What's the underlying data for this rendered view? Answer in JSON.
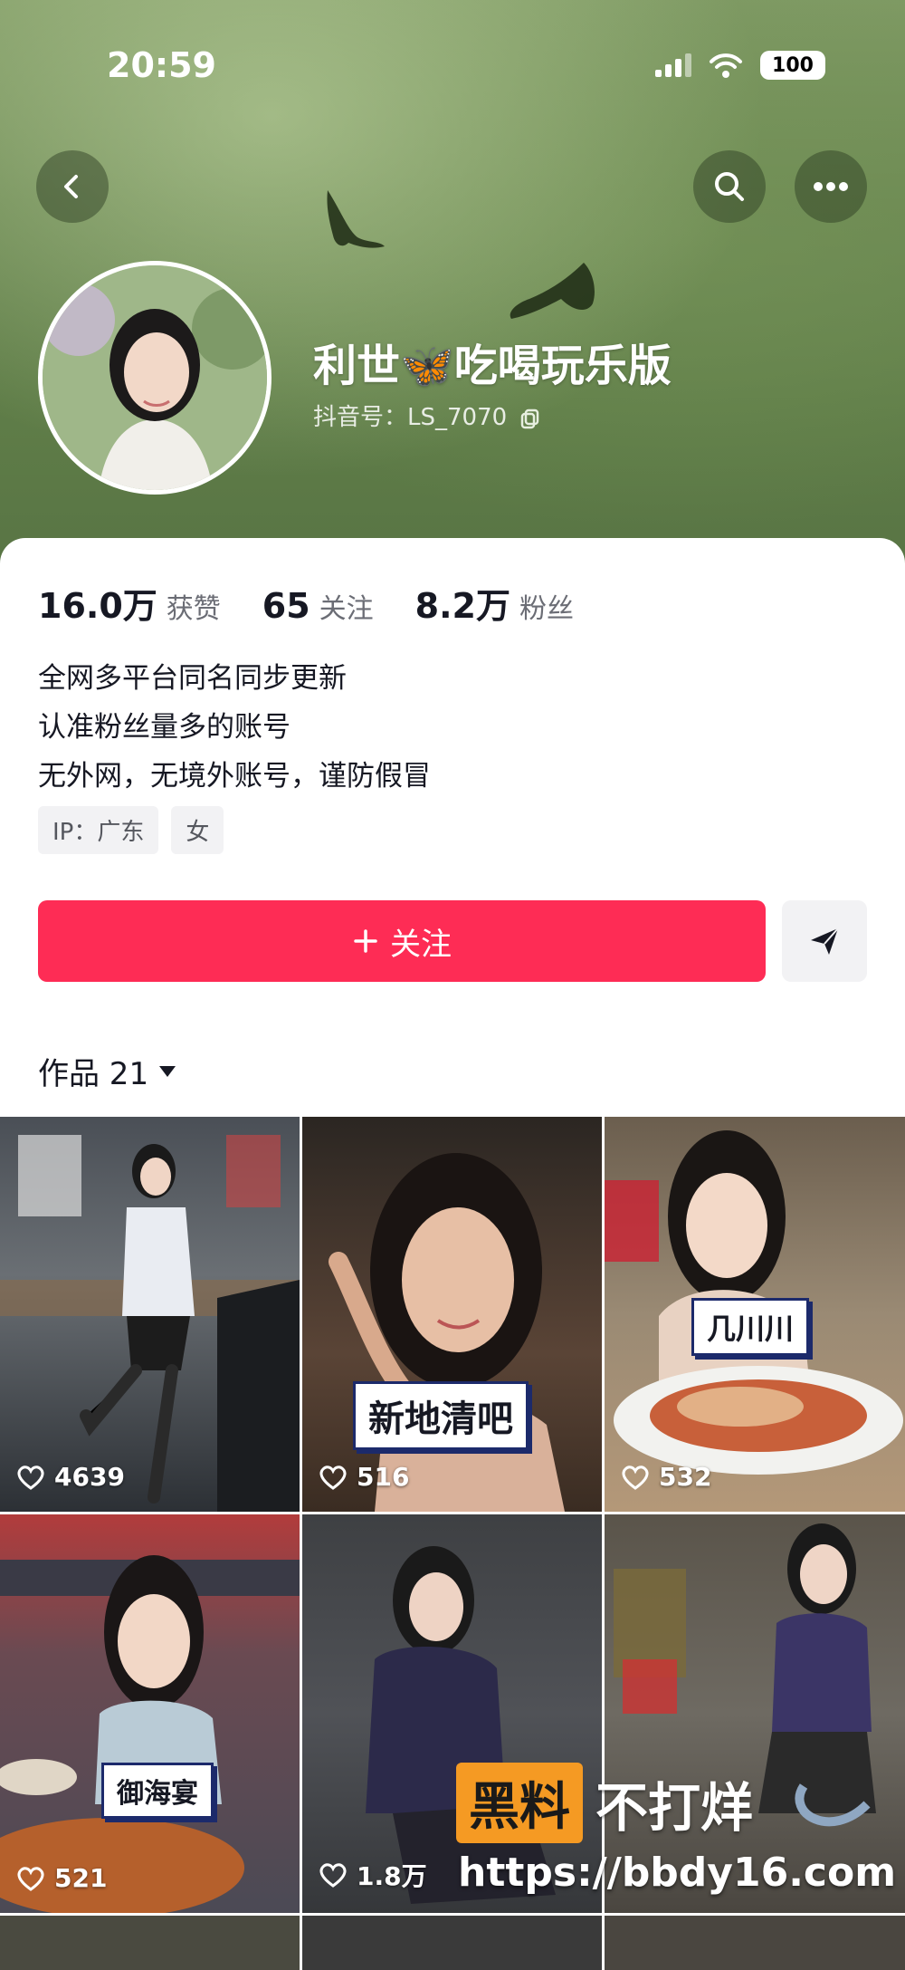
{
  "status_bar": {
    "time": "20:59",
    "battery": "100"
  },
  "profile": {
    "name": "利世🦋吃喝玩乐版",
    "douyin_id": "抖音号：LS_7070"
  },
  "stats": [
    {
      "value": "16.0万",
      "label": "获赞"
    },
    {
      "value": "65",
      "label": "关注"
    },
    {
      "value": "8.2万",
      "label": "粉丝"
    }
  ],
  "bio": [
    "全网多平台同名同步更新",
    "认准粉丝量多的账号",
    "无外网，无境外账号，谨防假冒"
  ],
  "tags": [
    "IP：广东",
    "女"
  ],
  "actions": {
    "follow_label": "关注"
  },
  "works": {
    "tab_label": "作品 21"
  },
  "videos": [
    {
      "likes": "4639",
      "caption": ""
    },
    {
      "likes": "516",
      "caption": "新地清吧"
    },
    {
      "likes": "532",
      "caption": "几川川"
    },
    {
      "likes": "521",
      "caption": "御海宴"
    },
    {
      "likes": "1.8万",
      "caption": ""
    },
    {
      "likes": "",
      "caption": ""
    }
  ],
  "watermark": {
    "box": "黑料",
    "text": "不打烊",
    "url": "https://bbdy16.com"
  },
  "colors": {
    "accent": "#fe2c55",
    "hero_green": "#6b8852"
  },
  "icons": [
    "back-icon",
    "search-icon",
    "more-icon",
    "copy-icon",
    "plus-icon",
    "send-icon",
    "caret-down-icon",
    "heart-icon"
  ]
}
